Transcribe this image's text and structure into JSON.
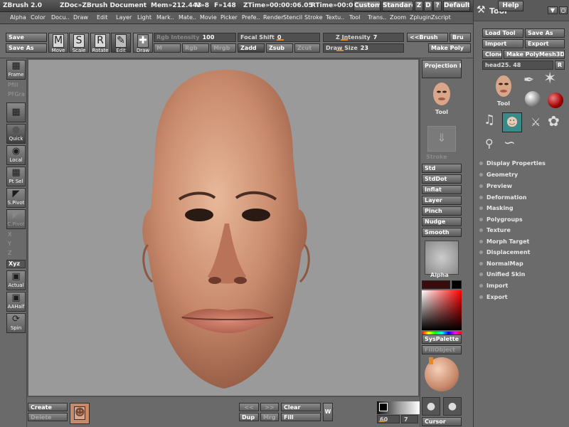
{
  "app": {
    "title": "ZBrush 2.0",
    "document": "ZDoc»ZBrush Document",
    "mem": "Mem»212.443",
    "vram": "V»8",
    "fps": "F»148",
    "ztime": "ZTime»00:00:06.05",
    "rtime": "RTime»00:00",
    "buttons": [
      "Custom",
      "Standard",
      "Z",
      "D",
      "?",
      "DefaultZScript",
      "Help"
    ]
  },
  "menu": [
    "Alpha",
    "Color",
    "Docu..",
    "Draw",
    "Edit",
    "Layer",
    "Light",
    "Mark..",
    "Mate..",
    "Movie",
    "Picker",
    "Prefe..",
    "Render",
    "Stencil",
    "Stroke",
    "Textu..",
    "Tool",
    "Trans..",
    "Zoom",
    "Zplugin",
    "Zscript"
  ],
  "shelf": {
    "save": "Save",
    "save_as": "Save As",
    "move": "Move",
    "scale": "Scale",
    "rotate": "Rotate",
    "edit": "Edit",
    "draw": "Draw",
    "rgb_intensity_label": "Rgb Intensity",
    "rgb_intensity_value": "100",
    "m": "M",
    "rgb": "Rgb",
    "mrgb": "Mrgb",
    "focal_shift_label": "Focal Shift",
    "focal_shift_value": "0",
    "zadd": "Zadd",
    "zsub": "Zsub",
    "zcut": "Zcut",
    "z_intensity_label": "Z Intensity",
    "z_intensity_value": "7",
    "draw_size_label": "Draw Size",
    "draw_size_value": "23",
    "brush_toggle": "<<Brush",
    "brush_trunc": "Bru",
    "make_poly": "Make Poly"
  },
  "left": {
    "frame": "Frame",
    "pfill": "Pfill",
    "pfgra": "PFGra",
    "quick": "Quick",
    "local": "Local",
    "ptsel": "Pt Sel",
    "spivot": "S.Pivot",
    "cpivot": "C.Pivot",
    "x": "X",
    "y": "Y",
    "z": "Z",
    "xyz": "Xyz",
    "actual": "Actual",
    "aahalf": "AAHalf",
    "spin": "Spin"
  },
  "right": {
    "projection_master": "Projection Master",
    "tool": "Tool",
    "stroke": "Stroke",
    "brushes": [
      "Std",
      "StdDot",
      "Inflat",
      "Layer",
      "Pinch",
      "Nudge",
      "Smooth"
    ],
    "alpha": "Alpha",
    "syspalette": "SysPalette",
    "fillobject": "FillObject",
    "cursor": "Cursor"
  },
  "bottom": {
    "create": "Create",
    "delete": "Delete",
    "back": "<<",
    "fwd": ">>",
    "clear": "Clear",
    "dup": "Dup",
    "mrg": "Mrg",
    "fill": "Fill",
    "w": "W",
    "r_value": "60",
    "t_value": "7"
  },
  "toolpanel": {
    "title": "Tool",
    "load_tool": "Load Tool",
    "save_as": "Save As",
    "import": "Import",
    "export": "Export",
    "clone": "Clone",
    "make_polymesh": "Make PolyMesh3D",
    "current_tool": "head25. 48",
    "current_label": "Tool",
    "sections": [
      "Display Properties",
      "Geometry",
      "Preview",
      "Deformation",
      "Masking",
      "Polygroups",
      "Texture",
      "Morph Target",
      "Displacement",
      "NormalMap",
      "Unified Skin",
      "Import",
      "Export"
    ]
  },
  "colors": {
    "accent": "#e08a2a",
    "canvas_bg": "#9a9a9a",
    "skin": "#c98a6c"
  }
}
